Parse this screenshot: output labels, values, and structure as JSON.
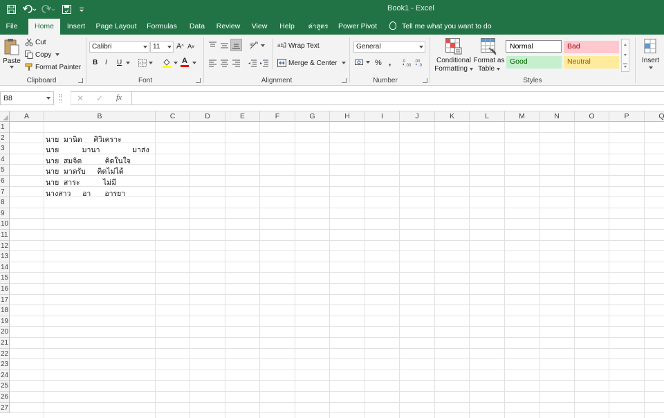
{
  "window": {
    "title": "Book1  -  Excel"
  },
  "quick_access": {
    "save_icon": "save-icon",
    "undo_icon": "undo-icon",
    "redo_icon": "redo-icon",
    "touch_icon": "touch-mode-icon",
    "customize_icon": "customize-icon"
  },
  "tabs": [
    {
      "label": "File"
    },
    {
      "label": "Home"
    },
    {
      "label": "Insert"
    },
    {
      "label": "Page Layout"
    },
    {
      "label": "Formulas"
    },
    {
      "label": "Data"
    },
    {
      "label": "Review"
    },
    {
      "label": "View"
    },
    {
      "label": "Help"
    },
    {
      "label": "ค่าสูตร"
    },
    {
      "label": "Power Pivot"
    }
  ],
  "tell_me": "Tell me what you want to do",
  "clipboard": {
    "label": "Clipboard",
    "paste": "Paste",
    "cut": "Cut",
    "copy": "Copy",
    "format_painter": "Format Painter"
  },
  "font": {
    "label": "Font",
    "name": "Calibri",
    "size": "11",
    "bold": "B",
    "italic": "I",
    "underline": "U",
    "grow": "A",
    "shrink": "A",
    "font_color": "A"
  },
  "alignment": {
    "label": "Alignment",
    "wrap_text": "Wrap Text",
    "merge_center": "Merge & Center"
  },
  "number": {
    "label": "Number",
    "format": "General",
    "percent": "%",
    "comma": ","
  },
  "styles": {
    "label": "Styles",
    "conditional_formatting": [
      "Conditional",
      "Formatting"
    ],
    "format_as_table": [
      "Format as",
      "Table"
    ],
    "cells": [
      {
        "name": "Normal",
        "bg": "#ffffff",
        "fg": "#000000"
      },
      {
        "name": "Bad",
        "bg": "#ffc7ce",
        "fg": "#9c0006"
      },
      {
        "name": "Good",
        "bg": "#c6efce",
        "fg": "#006100"
      },
      {
        "name": "Neutral",
        "bg": "#ffeb9c",
        "fg": "#9c5700"
      }
    ]
  },
  "cells_group": {
    "insert": "Insert"
  },
  "formula_bar": {
    "name_box": "B8",
    "cancel": "✕",
    "enter": "✓",
    "fx": "fx",
    "value": ""
  },
  "columns": [
    "A",
    "B",
    "C",
    "D",
    "E",
    "F",
    "G",
    "H",
    "I",
    "J",
    "K",
    "L",
    "M",
    "N",
    "O",
    "P",
    "Q"
  ],
  "rows": [
    "1",
    "2",
    "3",
    "4",
    "5",
    "6",
    "7",
    "8",
    "9",
    "10",
    "11",
    "12",
    "13",
    "14",
    "15",
    "16",
    "17",
    "18",
    "19",
    "20",
    "21",
    "22",
    "23",
    "24",
    "25",
    "26",
    "27"
  ],
  "cells": [
    {
      "ref": "B2",
      "text": "นาย  มานิต     ศิวิเคราะ"
    },
    {
      "ref": "B3",
      "text": "นาย          มานา              มาส่ง"
    },
    {
      "ref": "B4",
      "text": "นาย  สมจิต          คิดในใจ"
    },
    {
      "ref": "B5",
      "text": "นาย  มาดรับ     คิดไม่ได้"
    },
    {
      "ref": "B6",
      "text": "นาย  สาระ          ไม่มี"
    },
    {
      "ref": "B7",
      "text": "นางสาว     อา      อารยา"
    }
  ],
  "colors": {
    "excel_green": "#217346",
    "ribbon_bg": "#f3f3f3"
  }
}
